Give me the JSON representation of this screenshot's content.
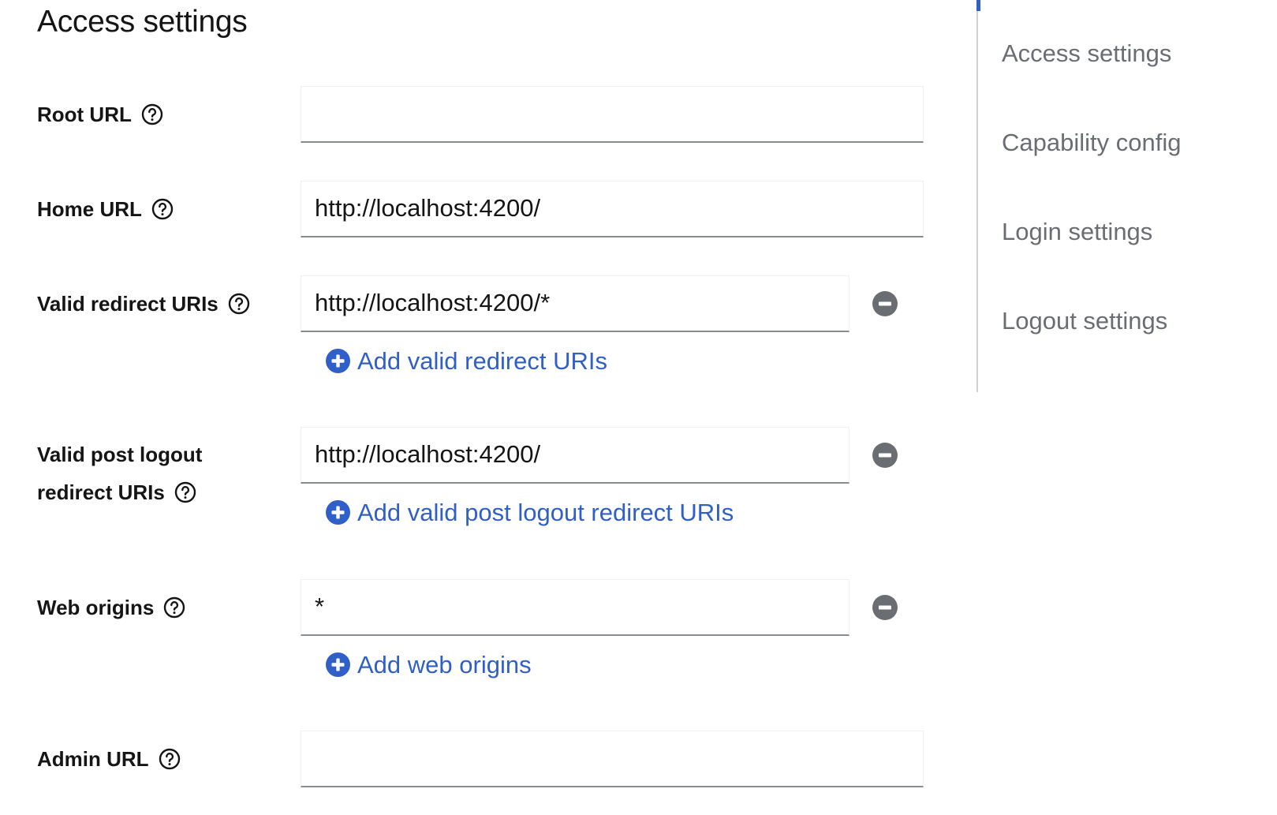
{
  "page": {
    "title": "Access settings"
  },
  "form": {
    "root_url": {
      "label": "Root URL",
      "value": ""
    },
    "home_url": {
      "label": "Home URL",
      "value": "http://localhost:4200/"
    },
    "valid_redirect_uris": {
      "label": "Valid redirect URIs",
      "value": "http://localhost:4200/*",
      "add_label": "Add valid redirect URIs"
    },
    "valid_post_logout": {
      "label_line1": "Valid post logout",
      "label_line2": "redirect URIs",
      "value": "http://localhost:4200/",
      "add_label": "Add valid post logout redirect URIs"
    },
    "web_origins": {
      "label": "Web origins",
      "value": "*",
      "add_label": "Add web origins"
    },
    "admin_url": {
      "label": "Admin URL",
      "value": ""
    }
  },
  "jump_links": {
    "items": [
      {
        "label": "Access settings"
      },
      {
        "label": "Capability config"
      },
      {
        "label": "Login settings"
      },
      {
        "label": "Logout settings"
      }
    ]
  },
  "icons": {
    "help": "help-circle-icon",
    "remove": "minus-circle-icon",
    "add": "plus-circle-icon"
  },
  "colors": {
    "link": "#2f5fc7",
    "jump_text": "#6a6e73",
    "remove_icon": "#6a6e73",
    "input_border": "#8a8d90"
  }
}
